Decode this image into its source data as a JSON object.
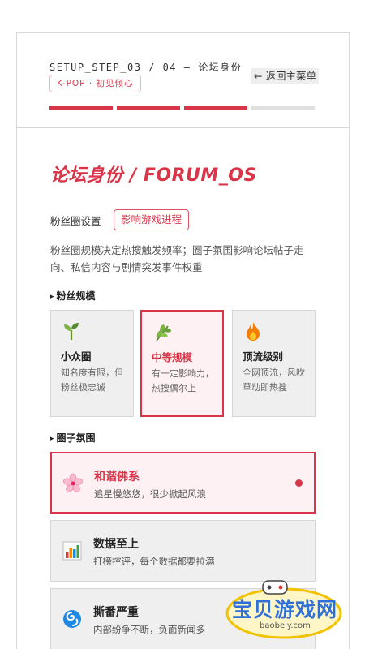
{
  "header": {
    "step_label": "SETUP_STEP_03 / 04 — 论坛身份",
    "back_label": "← 返回主菜单",
    "tag_label": "K-POP · 初见倾心",
    "progress": {
      "total_steps": 4,
      "completed_steps": 3
    }
  },
  "page": {
    "title": "论坛身份 / FORUM_OS",
    "setting_label": "粉丝圈设置",
    "effect_badge": "影响游戏进程",
    "description": "粉丝圈规模决定热搜触发频率；圈子氛围影响论坛帖子走向、私信内容与剧情突发事件权重"
  },
  "scale_section": {
    "title": "粉丝规模",
    "selected_index": 1,
    "options": [
      {
        "name": "小众圈",
        "desc": "知名度有限，但粉丝极忠诚",
        "icon": "seedling-icon"
      },
      {
        "name": "中等规模",
        "desc": "有一定影响力，热搜偶尔上",
        "icon": "herb-icon"
      },
      {
        "name": "顶流级别",
        "desc": "全网顶流，风吹草动即热搜",
        "icon": "fire-icon"
      }
    ]
  },
  "atmosphere_section": {
    "title": "圈子氛围",
    "selected_index": 0,
    "options": [
      {
        "name": "和谐佛系",
        "desc": "追星慢悠悠，很少掀起风浪",
        "icon": "cherry-blossom-icon"
      },
      {
        "name": "数据至上",
        "desc": "打榜控评，每个数据都要拉满",
        "icon": "bar-chart-icon"
      },
      {
        "name": "撕番严重",
        "desc": "内部纷争不断，负面新闻多",
        "icon": "cyclone-icon"
      }
    ]
  },
  "watermark": {
    "text": "宝贝游戏网",
    "url": "baobeiy.com"
  },
  "colors": {
    "accent": "#d93549",
    "card_bg": "#efefef",
    "selected_bg": "#fdf1f3"
  }
}
